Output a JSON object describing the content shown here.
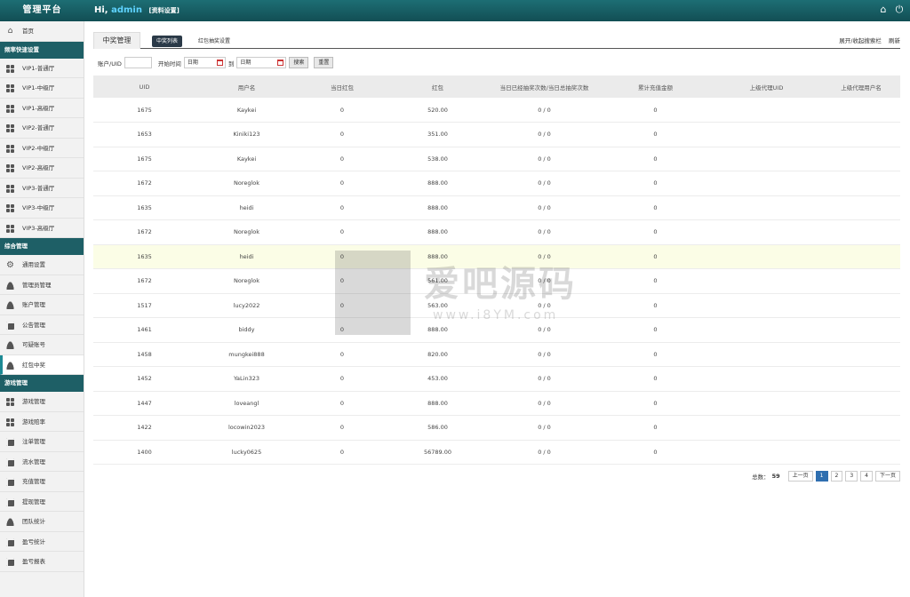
{
  "header": {
    "brand": "管理平台",
    "greeting": "Hi,",
    "user": "admin",
    "profile_link": "[资料设置]",
    "icons": [
      "home-icon",
      "power-icon"
    ]
  },
  "sidebar": {
    "home": "首页",
    "sections": [
      {
        "title": "频率快速设置",
        "items": [
          "VIP1-普通厅",
          "VIP1-中级厅",
          "VIP1-高级厅",
          "VIP2-普通厅",
          "VIP2-中级厅",
          "VIP2-高级厅",
          "VIP3-普通厅",
          "VIP3-中级厅",
          "VIP3-高级厅"
        ]
      },
      {
        "title": "综合管理",
        "items": [
          "通用设置",
          "管理员管理",
          "账户管理",
          "公告管理",
          "可疑账号",
          "红包中奖"
        ]
      },
      {
        "title": "游戏管理",
        "items": [
          "游戏管理",
          "游戏赔率",
          "注单管理",
          "流水管理",
          "充值管理",
          "提现管理",
          "团队统计",
          "盈亏统计",
          "盈亏报表"
        ]
      }
    ],
    "active": "红包中奖"
  },
  "main": {
    "page_tab": "中奖管理",
    "subtabs": [
      "中奖列表",
      "红包抽奖设置"
    ],
    "right_links": [
      "展开/收起搜索栏",
      "刷新"
    ],
    "filters": {
      "account_label": "账户/UID",
      "start_label": "开始时间",
      "to_label": "到",
      "date_placeholder": "日期",
      "search_btn": "搜索",
      "reset_btn": "重置"
    },
    "table": {
      "columns": [
        "UID",
        "用户名",
        "当日红包",
        "红包",
        "当日已经抽奖次数/当日总抽奖次数",
        "累计充值金额",
        "上级代理UID",
        "上级代理用户名"
      ],
      "rows": [
        [
          "1675",
          "Kaykei",
          "0",
          "520.00",
          "0 / 0",
          "0",
          "",
          ""
        ],
        [
          "1653",
          "Kiniki123",
          "0",
          "351.00",
          "0 / 0",
          "0",
          "",
          ""
        ],
        [
          "1675",
          "Kaykei",
          "0",
          "538.00",
          "0 / 0",
          "0",
          "",
          ""
        ],
        [
          "1672",
          "Noreglok",
          "0",
          "888.00",
          "0 / 0",
          "0",
          "",
          ""
        ],
        [
          "1635",
          "heidi",
          "0",
          "888.00",
          "0 / 0",
          "0",
          "",
          ""
        ],
        [
          "1672",
          "Noreglok",
          "0",
          "888.00",
          "0 / 0",
          "0",
          "",
          ""
        ],
        [
          "1635",
          "heidi",
          "0",
          "888.00",
          "0 / 0",
          "0",
          "",
          ""
        ],
        [
          "1672",
          "Noreglok",
          "0",
          "561.00",
          "0 / 0",
          "0",
          "",
          ""
        ],
        [
          "1517",
          "lucy2022",
          "0",
          "563.00",
          "0 / 0",
          "0",
          "",
          ""
        ],
        [
          "1461",
          "biddy",
          "0",
          "888.00",
          "0 / 0",
          "0",
          "",
          ""
        ],
        [
          "1458",
          "mungkei888",
          "0",
          "820.00",
          "0 / 0",
          "0",
          "",
          ""
        ],
        [
          "1452",
          "YaLin323",
          "0",
          "453.00",
          "0 / 0",
          "0",
          "",
          ""
        ],
        [
          "1447",
          "loveangl",
          "0",
          "888.00",
          "0 / 0",
          "0",
          "",
          ""
        ],
        [
          "1422",
          "locowin2023",
          "0",
          "586.00",
          "0 / 0",
          "0",
          "",
          ""
        ],
        [
          "1400",
          "lucky0625",
          "0",
          "56789.00",
          "0 / 0",
          "0",
          "",
          ""
        ]
      ],
      "highlight_row": 6
    },
    "pager": {
      "total_label": "总数：",
      "total": "59",
      "prev": "上一页",
      "pages": [
        "1",
        "2",
        "3",
        "4"
      ],
      "current": "1",
      "next": "下一页"
    }
  },
  "watermark": {
    "text": "爱吧源码",
    "url": "www.i8YM.com"
  }
}
